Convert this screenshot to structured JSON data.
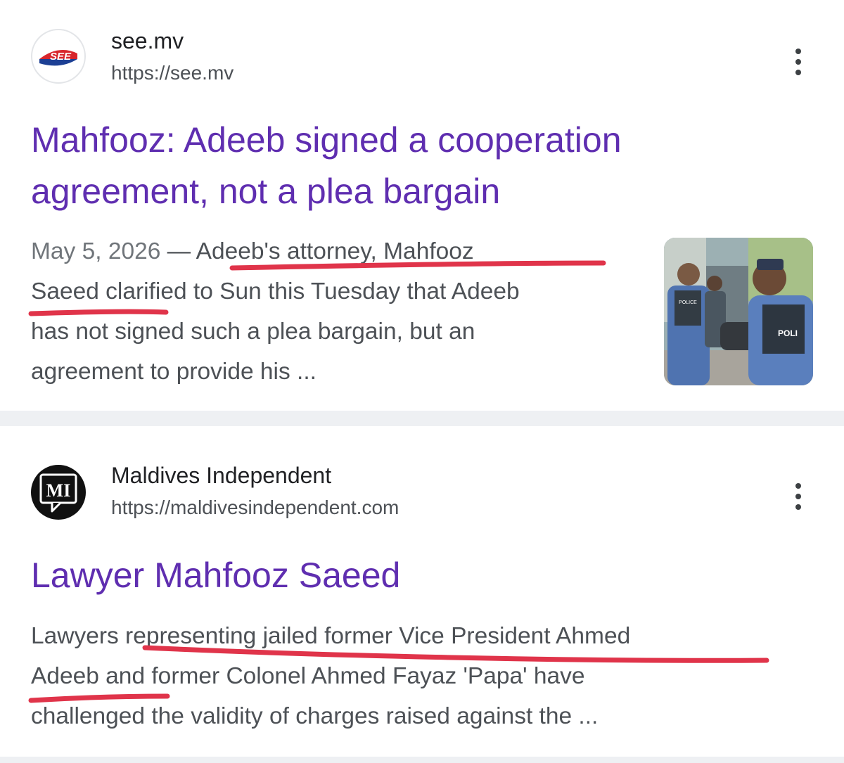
{
  "results": [
    {
      "site_name": "see.mv",
      "site_url": "https://see.mv",
      "favicon_text": "SEE",
      "title_line1": "Mahfooz: Adeeb signed a cooperation",
      "title_line2": "agreement, not a plea bargain",
      "date": "May 5, 2026",
      "date_sep": " — ",
      "snippet_line1_rest": "Adeeb's attorney, Mahfooz",
      "snippet_line2": "Saeed clarified to Sun this Tuesday that Adeeb",
      "snippet_line3": "has not signed such a plea bargain, but an",
      "snippet_line4": "agreement to provide his ...",
      "thumbnail_text_left": "POLICE",
      "thumbnail_text_right": "POLI",
      "menu_icon": "more-vert-icon"
    },
    {
      "site_name": "Maldives Independent",
      "site_url": "https://maldivesindependent.com",
      "favicon_text": "MI",
      "title_line1": "Lawyer Mahfooz Saeed",
      "snippet_line1": "Lawyers representing jailed former Vice President Ahmed",
      "snippet_line2": "Adeeb and former Colonel Ahmed Fayaz 'Papa' have",
      "snippet_line3": "challenged the validity of charges raised against the ...",
      "menu_icon": "more-vert-icon"
    }
  ],
  "colors": {
    "title_link": "#5f2eb0",
    "annotation_underline": "#e0344a",
    "separator": "#eef0f3",
    "snippet_text": "#4d5156"
  }
}
